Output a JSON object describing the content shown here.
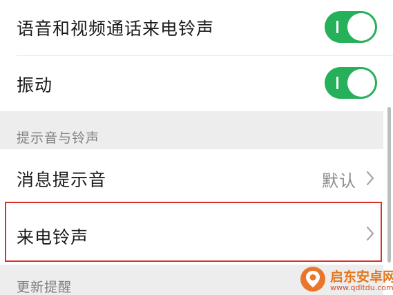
{
  "settings": {
    "voice_video_ringtone": {
      "label": "语音和视频通话来电铃声",
      "enabled": true
    },
    "vibrate": {
      "label": "振动",
      "enabled": true
    },
    "sound_section": {
      "title": "提示音与铃声"
    },
    "message_tone": {
      "label": "消息提示音",
      "value": "默认"
    },
    "incoming_ringtone": {
      "label": "来电铃声"
    },
    "update_section": {
      "title": "更新提醒"
    }
  },
  "watermark": {
    "title": "启东安卓网",
    "url": "www.qdltdu.com"
  },
  "colors": {
    "toggle_on": "#27b05a",
    "highlight_border": "#d9302c",
    "section_background": "#ededed"
  },
  "icons": {
    "row_arrow": "chevron-right-icon",
    "toggle": "toggle-switch-icon",
    "watermark_logo": "map-pin-logo-icon"
  }
}
